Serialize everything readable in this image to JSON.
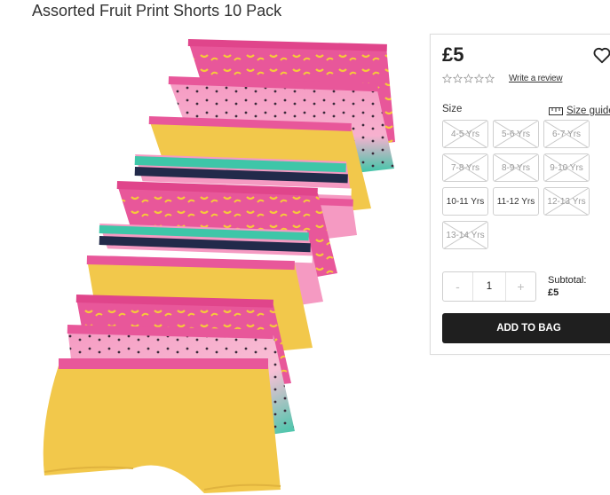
{
  "product": {
    "title": "Assorted Fruit Print Shorts 10 Pack",
    "price": "£5",
    "review_link": "Write a review",
    "rating_stars": 0
  },
  "sizes": {
    "label": "Size",
    "guide_label": "Size guide",
    "options": [
      {
        "label": "4-5 Yrs",
        "available": false
      },
      {
        "label": "5-6 Yrs",
        "available": false
      },
      {
        "label": "6-7 Yrs",
        "available": false
      },
      {
        "label": "7-8 Yrs",
        "available": false
      },
      {
        "label": "8-9 Yrs",
        "available": false
      },
      {
        "label": "9-10 Yrs",
        "available": false
      },
      {
        "label": "10-11 Yrs",
        "available": true
      },
      {
        "label": "11-12 Yrs",
        "available": true
      },
      {
        "label": "12-13 Yrs",
        "available": false
      },
      {
        "label": "13-14 Yrs",
        "available": false
      }
    ]
  },
  "quantity": {
    "minus": "-",
    "value": "1",
    "plus": "+"
  },
  "subtotal": {
    "label": "Subtotal:",
    "amount": "£5"
  },
  "cart": {
    "add_label": "ADD TO BAG"
  },
  "icons": {
    "wishlist": "heart-outline-icon",
    "size_guide": "ruler-icon",
    "rating": "star-outline-icon"
  },
  "colors": {
    "pink": "#e8579a",
    "light_pink": "#f59ac2",
    "yellow": "#f2c84b",
    "teal": "#3ec6a8",
    "navy": "#222a4a",
    "button_dark": "#1f1f1f"
  }
}
